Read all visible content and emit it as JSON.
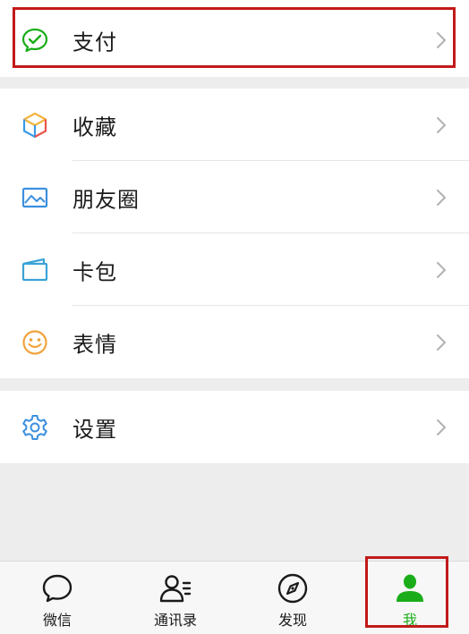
{
  "colors": {
    "accent_green": "#1aad19",
    "highlight_red": "#c11a1a",
    "text": "#1a1a1a",
    "chevron": "#b2b2b2",
    "page_bg": "#ededed"
  },
  "groups": {
    "pay": {
      "items": [
        {
          "label": "支付",
          "icon": "pay-check-icon"
        }
      ]
    },
    "main": {
      "items": [
        {
          "label": "收藏",
          "icon": "cube-icon"
        },
        {
          "label": "朋友圈",
          "icon": "image-icon"
        },
        {
          "label": "卡包",
          "icon": "card-wallet-icon"
        },
        {
          "label": "表情",
          "icon": "smile-icon"
        }
      ]
    },
    "settings": {
      "items": [
        {
          "label": "设置",
          "icon": "gear-icon"
        }
      ]
    }
  },
  "tabbar": {
    "tabs": [
      {
        "label": "微信",
        "icon": "chat-bubble-icon",
        "active": false
      },
      {
        "label": "通讯录",
        "icon": "contacts-icon",
        "active": false
      },
      {
        "label": "发现",
        "icon": "compass-icon",
        "active": false
      },
      {
        "label": "我",
        "icon": "person-icon",
        "active": true
      }
    ]
  }
}
